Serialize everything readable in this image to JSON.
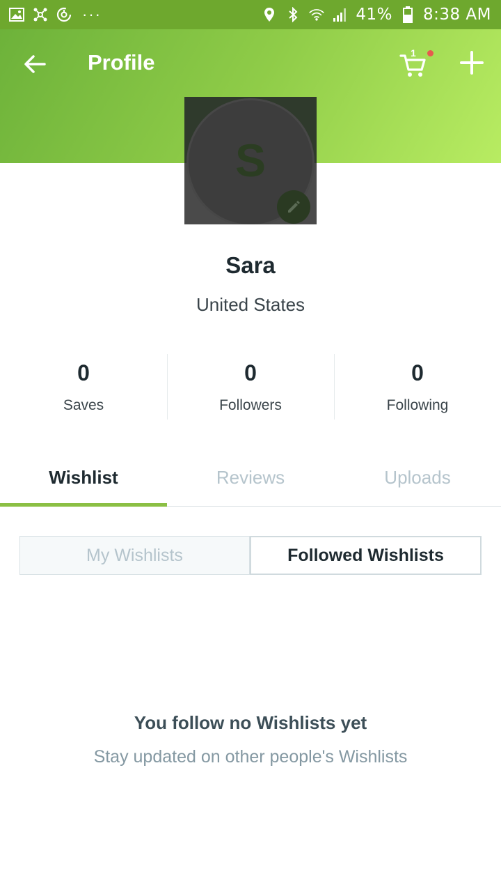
{
  "status_bar": {
    "battery": "41%",
    "time": "8:38 AM",
    "left_icons": [
      "image-icon",
      "network-icon",
      "sync-icon",
      "more-notifications-icon"
    ],
    "right_icons": [
      "location-icon",
      "bluetooth-icon",
      "wifi-icon",
      "signal-icon",
      "battery-icon"
    ]
  },
  "header": {
    "title": "Profile",
    "cart_count": "1",
    "accent_color": "#8bbf44"
  },
  "profile": {
    "initial": "S",
    "name": "Sara",
    "location": "United States"
  },
  "stats": [
    {
      "value": "0",
      "label": "Saves"
    },
    {
      "value": "0",
      "label": "Followers"
    },
    {
      "value": "0",
      "label": "Following"
    }
  ],
  "tabs": [
    {
      "label": "Wishlist",
      "active": true
    },
    {
      "label": "Reviews",
      "active": false
    },
    {
      "label": "Uploads",
      "active": false
    }
  ],
  "wishlist_toggle": {
    "my_label": "My Wishlists",
    "followed_label": "Followed Wishlists",
    "selected": "Followed Wishlists"
  },
  "empty_state": {
    "title": "You follow no Wishlists yet",
    "subtitle": "Stay updated on other people's Wishlists"
  }
}
